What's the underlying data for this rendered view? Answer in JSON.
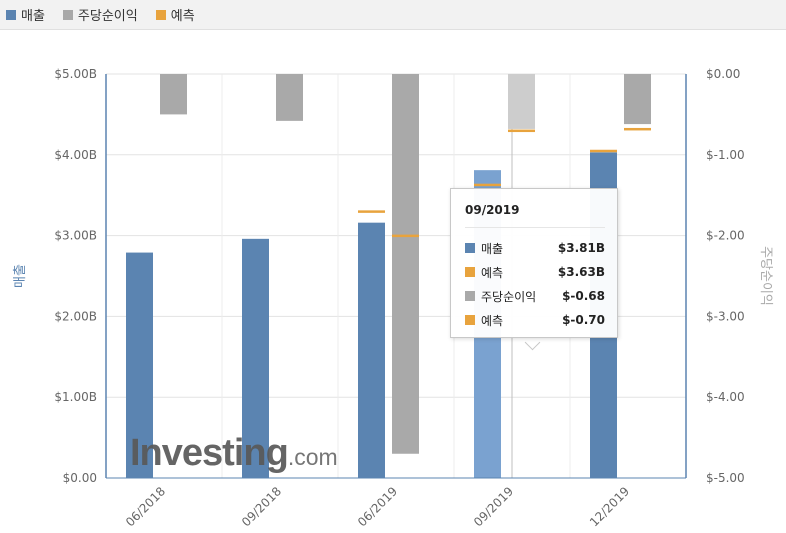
{
  "legend": {
    "items": [
      {
        "label": "매출",
        "color": "#5b84b1"
      },
      {
        "label": "주당순이익",
        "color": "#a9a9a9"
      },
      {
        "label": "예측",
        "color": "#e8a33d"
      }
    ]
  },
  "chart_data": {
    "type": "bar",
    "categories": [
      "06/2018",
      "09/2018",
      "06/2019",
      "09/2019",
      "12/2019"
    ],
    "left_axis": {
      "title": "매출",
      "ticks": [
        "$0.00",
        "$1.00B",
        "$2.00B",
        "$3.00B",
        "$4.00B",
        "$5.00B"
      ],
      "range": [
        0,
        5
      ]
    },
    "right_axis": {
      "title": "주당순이익",
      "ticks": [
        "$0.00",
        "$-1.00",
        "$-2.00",
        "$-3.00",
        "$-4.00",
        "$-5.00"
      ],
      "range": [
        0,
        -5
      ]
    },
    "series": [
      {
        "name": "매출",
        "axis": "left",
        "unit": "B",
        "values": [
          2.79,
          2.96,
          3.16,
          3.81,
          4.03
        ]
      },
      {
        "name": "주당순이익",
        "axis": "right",
        "values": [
          -0.5,
          -0.58,
          -4.7,
          -0.68,
          -0.62
        ]
      },
      {
        "name": "예측",
        "for": "매출",
        "axis": "left",
        "values": [
          null,
          null,
          3.3,
          3.63,
          4.05
        ]
      },
      {
        "name": "예측",
        "for": "주당순이익",
        "axis": "right",
        "values": [
          null,
          null,
          -2.0,
          -0.7,
          -0.68
        ]
      }
    ],
    "highlighted_index": 3,
    "grid": true
  },
  "colors": {
    "revenue": "#5b84b1",
    "revenue_highlight": "#7aa2d0",
    "eps": "#a9a9a9",
    "eps_highlight": "#cdcdcd",
    "forecast": "#e8a33d",
    "axis_left": "#5b84b1",
    "axis_right": "#a9a9a9"
  },
  "tooltip": {
    "title": "09/2019",
    "rows": [
      {
        "label": "매출",
        "value": "$3.81B",
        "color": "#5b84b1"
      },
      {
        "label": "예측",
        "value": "$3.63B",
        "color": "#e8a33d"
      },
      {
        "label": "주당순이익",
        "value": "$-0.68",
        "color": "#a9a9a9"
      },
      {
        "label": "예측",
        "value": "$-0.70",
        "color": "#e8a33d"
      }
    ]
  },
  "watermark": {
    "brand": "Investing",
    "suffix": ".com"
  }
}
